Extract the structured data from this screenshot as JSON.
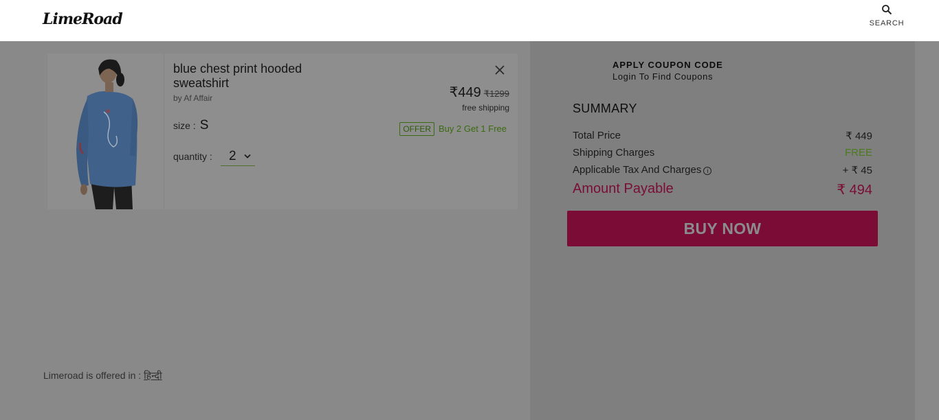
{
  "header": {
    "logo": "LimeRoad",
    "search_label": "SEARCH",
    "search_icon": "search-icon"
  },
  "cart_item": {
    "name": "blue chest print hooded sweatshirt",
    "brand": "by Af Affair",
    "price": "₹449",
    "mrp": "₹1299",
    "shipping": "free shipping",
    "size_label": "size :",
    "size_value": "S",
    "offer_badge": "OFFER",
    "offer_text": "Buy 2 Get 1 Free",
    "quantity_label": "quantity :",
    "quantity_value": "2"
  },
  "footer": {
    "lang_text": "Limeroad is offered in :",
    "lang_link": "हिन्दी"
  },
  "summary": {
    "coupon_title": "APPLY COUPON CODE",
    "coupon_sub": "Login To Find Coupons",
    "title": "SUMMARY",
    "rows": [
      {
        "label": "Total Price",
        "value": "₹ 449"
      },
      {
        "label": "Shipping Charges",
        "value": "FREE"
      },
      {
        "label": "Applicable Tax And Charges",
        "value": "+ ₹ 45"
      }
    ],
    "amount_label": "Amount Payable",
    "amount_value": "₹ 494",
    "buy_label": "BUY NOW"
  },
  "colors": {
    "overlay": "#898989",
    "accent": "#7a0c36",
    "free": "#4b7a1d"
  }
}
